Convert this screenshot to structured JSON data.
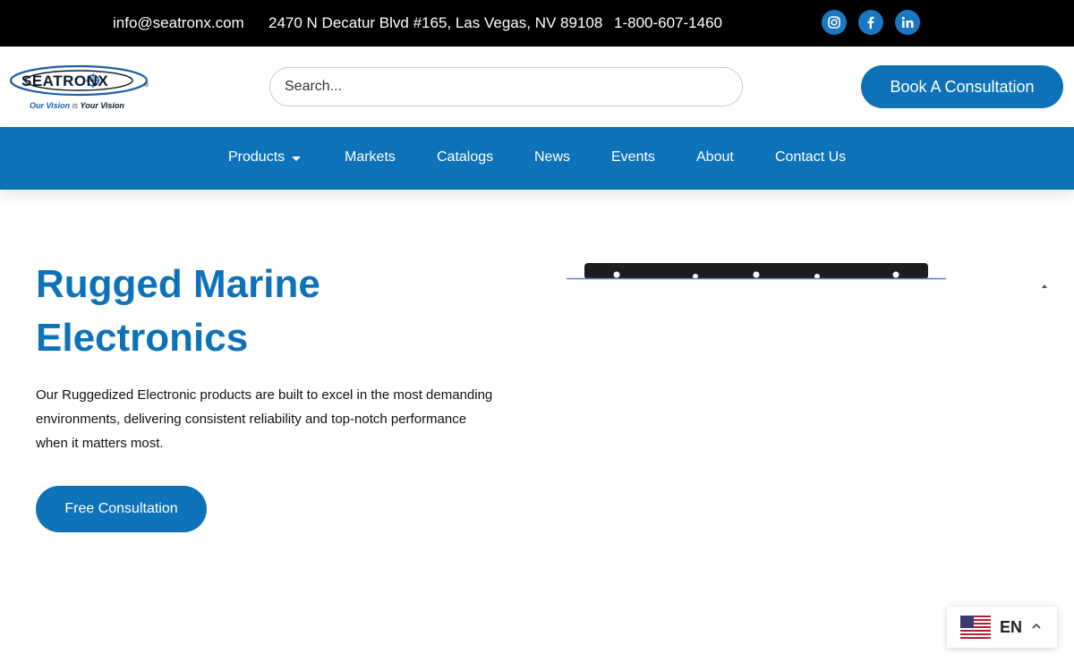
{
  "topbar": {
    "email": "info@seatronx.com",
    "address": "2470 N Decatur Blvd #165, Las Vegas, NV 89108",
    "phone": "1-800-607-1460",
    "social": [
      {
        "icon": "instagram-icon"
      },
      {
        "icon": "facebook-icon"
      },
      {
        "icon": "linkedin-icon"
      }
    ]
  },
  "header": {
    "logo": {
      "wordmark": "SEATRONX",
      "registered": "®",
      "tagline_part1": "Our Vision",
      "tagline_part2": "is",
      "tagline_part3": "Your Vision"
    },
    "search": {
      "placeholder": "Search...",
      "value": ""
    },
    "cta_label": "Book A Consultation"
  },
  "nav": {
    "items": [
      {
        "label": "Products",
        "has_dropdown": true
      },
      {
        "label": "Markets"
      },
      {
        "label": "Catalogs"
      },
      {
        "label": "News"
      },
      {
        "label": "Events"
      },
      {
        "label": "About"
      },
      {
        "label": "Contact Us"
      }
    ]
  },
  "hero": {
    "title_line1": "Rugged Marine",
    "title_line2": "Electronics",
    "description": "Our Ruggedized Electronic products are built to excel in the most demanding environments, delivering consistent reliability and top-notch performance when it matters most.",
    "button_label": "Free Consultation"
  },
  "language": {
    "code": "EN",
    "flag_icon": "us-flag-icon"
  },
  "colors": {
    "brand_blue": "#0e72b8",
    "topbar_bg": "#000000"
  }
}
